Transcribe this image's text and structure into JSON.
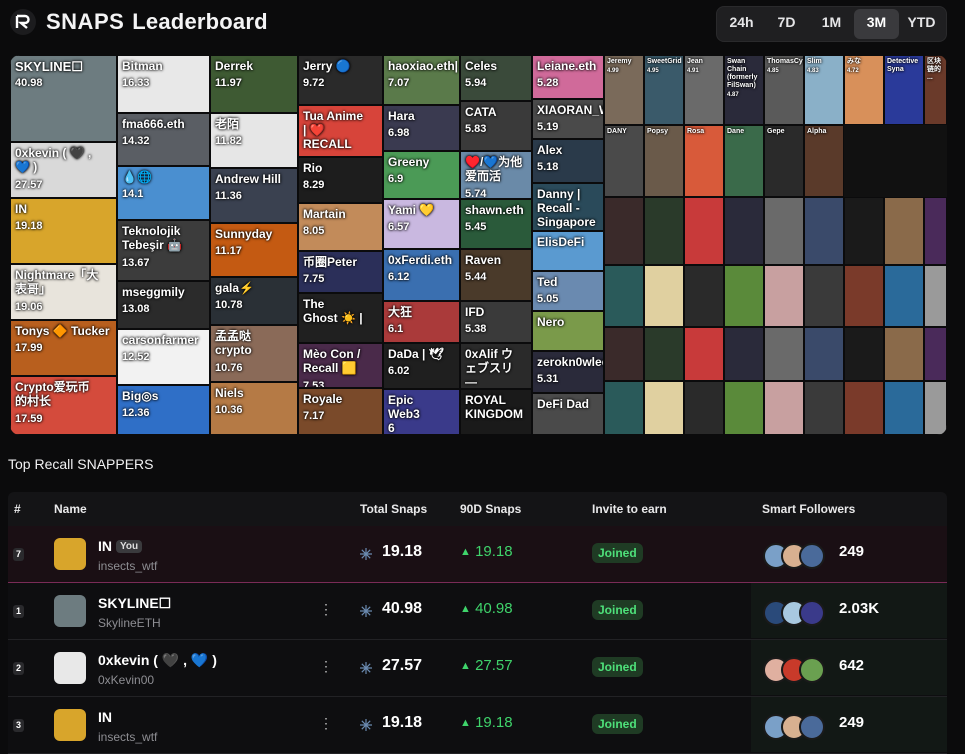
{
  "header": {
    "brand": "SNAPS",
    "title": "Leaderboard",
    "ranges": [
      "24h",
      "7D",
      "1M",
      "3M",
      "YTD"
    ],
    "active_range": "3M"
  },
  "mosaic": [
    {
      "name": "SKYLINE☐",
      "score": "40.98",
      "color": "#6d7c80"
    },
    {
      "name": "0xkevin ( 🖤 ,\n💙 )",
      "score": "27.57",
      "color": "#d9d9d9"
    },
    {
      "name": "IN",
      "score": "19.18",
      "color": "#d8a52b"
    },
    {
      "name": "Nightmare「大\n表哥」",
      "score": "19.06",
      "color": "#e8e4dc"
    },
    {
      "name": "Tonys 🔶 Tucker",
      "score": "17.99",
      "color": "#b85f1e"
    },
    {
      "name": "Crypto爱玩币\n的村长",
      "score": "17.59",
      "color": "#d44b3c"
    },
    {
      "name": "Bitman",
      "score": "16.33",
      "color": "#e8e8e8"
    },
    {
      "name": "fma666.eth",
      "score": "14.32",
      "color": "#5a5e64"
    },
    {
      "name": "💧🌐",
      "score": "14.1",
      "color": "#4a8fd0"
    },
    {
      "name": "Teknolojik\nTebeşir 🤖",
      "score": "13.67",
      "color": "#3c3c3c"
    },
    {
      "name": "mseggmily",
      "score": "13.08",
      "color": "#2b2b2b"
    },
    {
      "name": "carsonfarmer",
      "score": "12.52",
      "color": "#f2f2f2"
    },
    {
      "name": "Big◎s",
      "score": "12.36",
      "color": "#2f6fc7"
    },
    {
      "name": "Derrek",
      "score": "11.97",
      "color": "#3e5a33"
    },
    {
      "name": "老陌",
      "score": "11.82",
      "color": "#e6e6e6"
    },
    {
      "name": "Andrew Hill",
      "score": "11.36",
      "color": "#3a4150"
    },
    {
      "name": "Sunnyday",
      "score": "11.17",
      "color": "#c45a12"
    },
    {
      "name": "gala⚡",
      "score": "10.78",
      "color": "#2a3036"
    },
    {
      "name": "孟孟哒\ncrypto",
      "score": "10.76",
      "color": "#8a6a58"
    },
    {
      "name": "Niels",
      "score": "10.36",
      "color": "#b57a45"
    },
    {
      "name": "Jerry 🔵",
      "score": "9.72",
      "color": "#2a2a2a"
    },
    {
      "name": "Tua Anime\n| ❤️\nRECALL",
      "score": "",
      "color": "#d7443a"
    },
    {
      "name": "Rio",
      "score": "8.29",
      "color": "#1d1d1d"
    },
    {
      "name": "Martain",
      "score": "8.05",
      "color": "#c28b5a"
    },
    {
      "name": "币圈Peter",
      "score": "7.75",
      "color": "#2b2f59"
    },
    {
      "name": "The\nGhost ☀️ |",
      "score": "",
      "color": "#202020"
    },
    {
      "name": "Mèo Con /\nRecall 🟨",
      "score": "7.53",
      "color": "#4a2a4a"
    },
    {
      "name": "Royale",
      "score": "7.17",
      "color": "#7a4a2a"
    },
    {
      "name": "haoxiao.eth|",
      "score": "7.07",
      "color": "#5a7a4a"
    },
    {
      "name": "Hara",
      "score": "6.98",
      "color": "#3a3a50"
    },
    {
      "name": "Greeny",
      "score": "6.9",
      "color": "#4b9a56"
    },
    {
      "name": "Yami 💛",
      "score": "6.57",
      "color": "#c9b8e0"
    },
    {
      "name": "0xFerdi.eth",
      "score": "6.12",
      "color": "#3a6fb0"
    },
    {
      "name": "大狂",
      "score": "6.1",
      "color": "#aa3a3a"
    },
    {
      "name": "DaDa | 🕊",
      "score": "6.02",
      "color": "#1f1f1f"
    },
    {
      "name": "Epic\nWeb3\n6",
      "score": "",
      "color": "#3a3a8a"
    },
    {
      "name": "Celes",
      "score": "5.94",
      "color": "#3a4a3a"
    },
    {
      "name": "CATA",
      "score": "5.83",
      "color": "#3a3a3a"
    },
    {
      "name": "♥️/💙为他\n爱而活",
      "score": "5.74",
      "color": "#6a8aa8"
    },
    {
      "name": "shawn.eth",
      "score": "5.45",
      "color": "#2a5a3a"
    },
    {
      "name": "Raven",
      "score": "5.44",
      "color": "#4a3a2a"
    },
    {
      "name": "IFD",
      "score": "5.38",
      "color": "#3a3a3a"
    },
    {
      "name": "0xAlif ウ\nェブスリ\n—",
      "score": "",
      "color": "#2a2a2a"
    },
    {
      "name": "ROYAL\nKINGDOM",
      "score": "",
      "color": "#1a1a1a"
    },
    {
      "name": "Leiane.eth",
      "score": "5.28",
      "color": "#d06a9a"
    },
    {
      "name": "XIAORAN_WEB3",
      "score": "5.19",
      "color": "#4a4a4a"
    },
    {
      "name": "Alex",
      "score": "5.18",
      "color": "#2a3a4a"
    },
    {
      "name": "Danny |\nRecall -\nSingapore",
      "score": "",
      "color": "#2a4a5a"
    },
    {
      "name": "ElisDeFi",
      "score": "",
      "color": "#5a9ad0"
    },
    {
      "name": "Ted",
      "score": "5.05",
      "color": "#6a8ab0"
    },
    {
      "name": "Nero",
      "score": "",
      "color": "#7a9a4a"
    },
    {
      "name": "zerokn0wledge.hl",
      "score": "5.31",
      "color": "#2a2a3a"
    },
    {
      "name": "DeFi Dad",
      "score": "",
      "color": "#4a4a4a"
    },
    {
      "name": "Jeremy",
      "score": "4.99",
      "color": "#7a6a5a"
    },
    {
      "name": "SweetGrid",
      "score": "4.95",
      "color": "#3a5a6a"
    },
    {
      "name": "Jean",
      "score": "4.91",
      "color": "#6a6a6a"
    },
    {
      "name": "Swan\nChain\n(formerly\nFilSwan)",
      "score": "4.87",
      "color": "#2a2a3a"
    },
    {
      "name": "ThomasCyber",
      "score": "4.85",
      "color": "#5a5a5a"
    },
    {
      "name": "Slim",
      "score": "4.83",
      "color": "#8ab0c8"
    },
    {
      "name": "みな",
      "score": "4.72",
      "color": "#d8905a"
    },
    {
      "name": "Detective\nSyna",
      "score": "",
      "color": "#2a3a9a"
    },
    {
      "name": "区块链的\n...",
      "score": "",
      "color": "#6a3a2a"
    },
    {
      "name": "DANY",
      "score": "",
      "color": "#4a4a4a"
    },
    {
      "name": "Popsy",
      "score": "",
      "color": "#6a5a4a"
    },
    {
      "name": "Rosa",
      "score": "",
      "color": "#d85a3a"
    },
    {
      "name": "Dane",
      "score": "",
      "color": "#3a6a4a"
    },
    {
      "name": "Gepe",
      "score": "",
      "color": "#2a2a2a"
    },
    {
      "name": "Alpha",
      "score": "",
      "color": "#5a3a2a"
    }
  ],
  "section_title": "Top Recall SNAPPERS",
  "table": {
    "headers": [
      "#",
      "Name",
      "Total Snaps",
      "90D Snaps",
      "Invite to earn",
      "Smart Followers"
    ],
    "you_badge": "You",
    "rows": [
      {
        "rank": "7",
        "name": "IN",
        "handle": "insects_wtf",
        "total": "19.18",
        "ninety": "19.18",
        "invite": "Joined",
        "followers": "249",
        "me": true,
        "avatar_color": "#d8a52b"
      },
      {
        "rank": "1",
        "name": "SKYLINE☐",
        "handle": "SkylineETH",
        "total": "40.98",
        "ninety": "40.98",
        "invite": "Joined",
        "followers": "2.03K",
        "me": false,
        "avatar_color": "#6d7c80"
      },
      {
        "rank": "2",
        "name": "0xkevin ( 🖤 , 💙 )",
        "handle": "0xKevin00",
        "total": "27.57",
        "ninety": "27.57",
        "invite": "Joined",
        "followers": "642",
        "me": false,
        "avatar_color": "#e8e8e8"
      },
      {
        "rank": "3",
        "name": "IN",
        "handle": "insects_wtf",
        "total": "19.18",
        "ninety": "19.18",
        "invite": "Joined",
        "followers": "249",
        "me": false,
        "avatar_color": "#d8a52b"
      }
    ],
    "follower_avatar_colors": [
      [
        "#7aa0c8",
        "#d8b090",
        "#4a6a9a"
      ],
      [
        "#2a4a7a",
        "#a8c8e0",
        "#3a3a8a"
      ],
      [
        "#e0b0a0",
        "#c83a2a",
        "#6aa050"
      ],
      [
        "#7aa0c8",
        "#d8b090",
        "#4a6a9a"
      ]
    ]
  }
}
